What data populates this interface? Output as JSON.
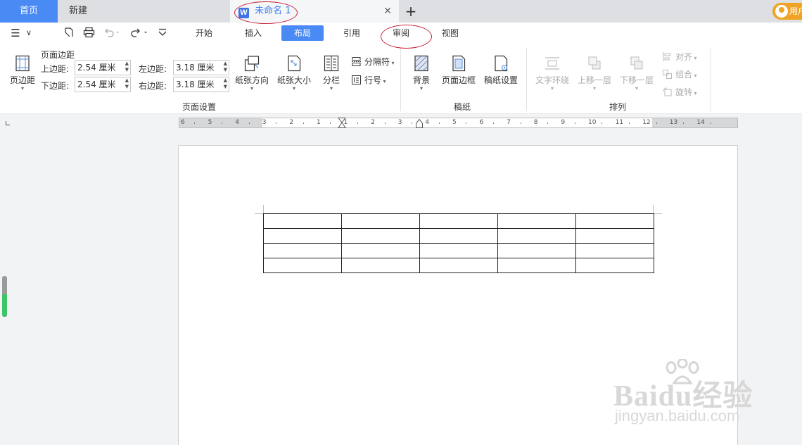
{
  "tabbar": {
    "home": "首页",
    "new": "新建",
    "doc_icon": "W",
    "doc_title": "未命名 1",
    "close": "✕",
    "add": "+",
    "user": "用户"
  },
  "quick_toolbar": {
    "menu_icon": "☰",
    "dropdown": "∨"
  },
  "menu": {
    "tabs": [
      "开始",
      "插入",
      "布局",
      "引用",
      "审阅",
      "视图"
    ],
    "active": "布局"
  },
  "ribbon": {
    "page_setup": {
      "margins_button": "页边距",
      "margins_title": "页面边距",
      "top_label": "上边距:",
      "top_value": "2.54 厘米",
      "bottom_label": "下边距:",
      "bottom_value": "2.54 厘米",
      "left_label": "左边距:",
      "left_value": "3.18 厘米",
      "right_label": "右边距:",
      "right_value": "3.18 厘米",
      "orientation": "纸张方向",
      "size": "纸张大小",
      "columns": "分栏",
      "breaks": "分隔符",
      "line_numbers": "行号",
      "group_title": "页面设置"
    },
    "paper": {
      "background": "背景",
      "page_border": "页面边框",
      "manuscript_setup": "稿纸设置",
      "group_title": "稿纸"
    },
    "arrange": {
      "wrap_text": "文字环绕",
      "bring_forward": "上移一层",
      "send_backward": "下移一层",
      "align": "对齐",
      "group": "组合",
      "rotate": "旋转",
      "group_title": "排列"
    }
  },
  "ruler": {
    "numbers": [
      {
        "t": "6"
      },
      {
        "t": "5"
      },
      {
        "t": "4"
      },
      {
        "t": "3"
      },
      {
        "t": "2"
      },
      {
        "t": "1"
      },
      {
        "t": "1"
      },
      {
        "t": "2"
      },
      {
        "t": "3"
      },
      {
        "t": "4"
      },
      {
        "t": "5"
      },
      {
        "t": "6"
      },
      {
        "t": "7"
      },
      {
        "t": "8"
      },
      {
        "t": "9"
      },
      {
        "t": "10"
      },
      {
        "t": "11"
      },
      {
        "t": "12"
      },
      {
        "t": "13"
      },
      {
        "t": "14"
      }
    ]
  },
  "document": {
    "table": {
      "rows": 4,
      "cols": 5
    }
  },
  "watermark": {
    "brand": "Baidu经验",
    "url": "jingyan.baidu.com"
  },
  "colors": {
    "accent": "#4a8af4",
    "annotation": "#c9203a",
    "user_badge": "#f0a325",
    "scroll_fill": "#3cc566"
  },
  "scroll_indicator": {
    "level": 0.55
  }
}
